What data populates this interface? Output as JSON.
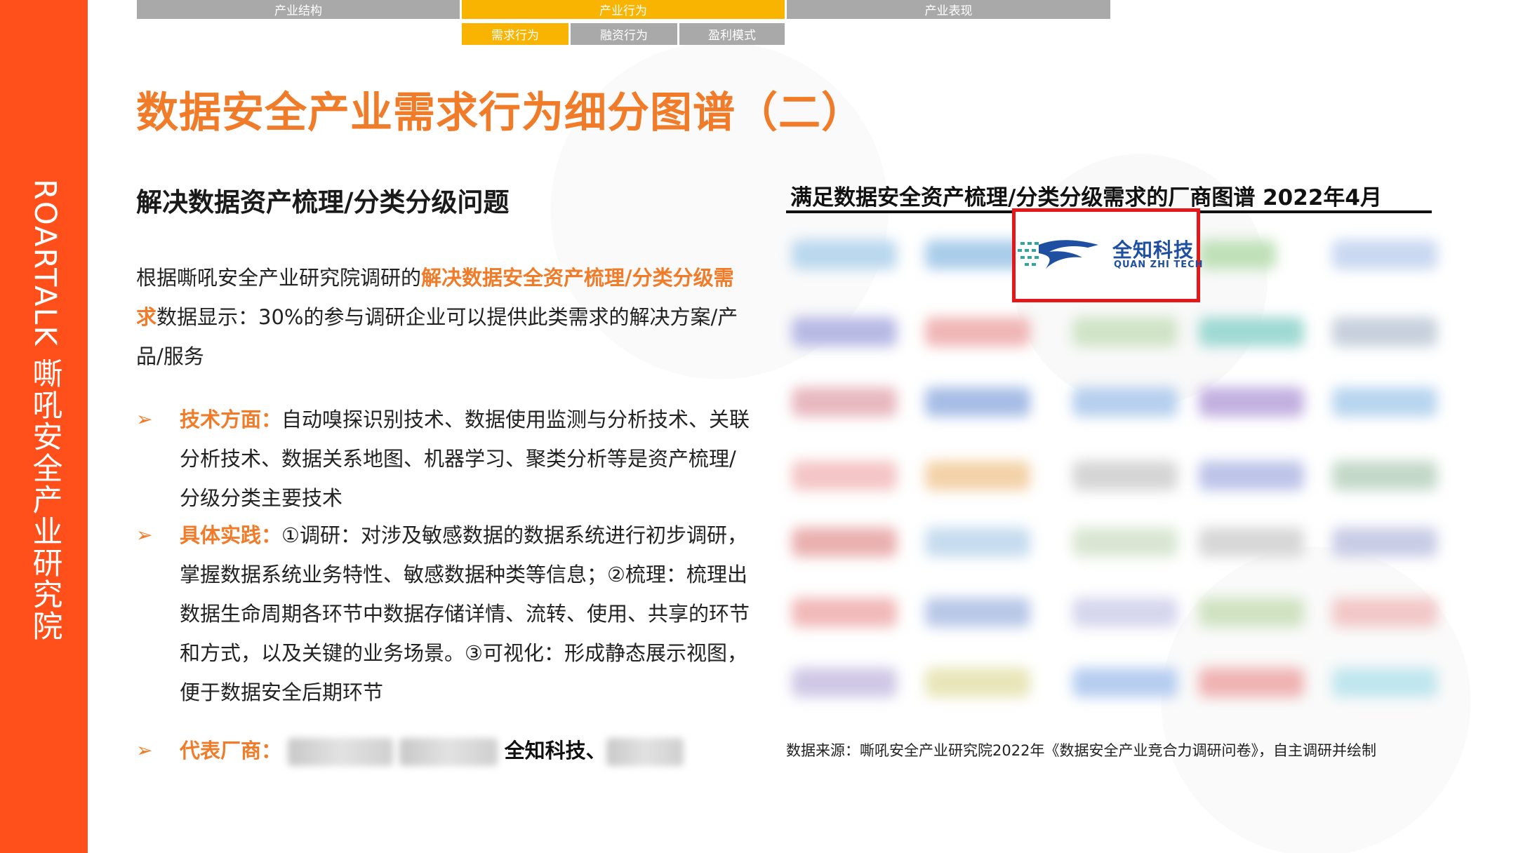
{
  "sidebar": {
    "text": "ROARTALK 嘶吼安全产业研究院"
  },
  "nav": {
    "top": [
      "产业结构",
      "产业行为",
      "产业表现"
    ],
    "sub": [
      "需求行为",
      "融资行为",
      "盈利模式"
    ],
    "active_top": "产业行为",
    "active_sub": "需求行为"
  },
  "page": {
    "title": "数据安全产业需求行为细分图谱（二）",
    "section_heading": "解决数据资产梳理/分类分级问题",
    "intro": {
      "pre": "根据嘶吼安全产业研究院调研的",
      "highlight": "解决数据安全资产梳理/分类分级需求",
      "post": "数据显示：30%的参与调研企业可以提供此类需求的解决方案/产品/服务"
    },
    "bullets": [
      {
        "label": "技术方面：",
        "text": "自动嗅探识别技术、数据使用监测与分析技术、关联分析技术、数据关系地图、机器学习、聚类分析等是资产梳理/分级分类主要技术"
      },
      {
        "label": "具体实践：",
        "text": "①调研：对涉及敏感数据的数据系统进行初步调研，掌握数据系统业务特性、敏感数据种类等信息；②梳理：梳理出数据生命周期各环节中数据存储详情、流转、使用、共享的环节和方式，以及关键的业务场景。③可视化：形成静态展示视图，便于数据安全后期环节"
      },
      {
        "label": "代表厂商：",
        "named_vendor": "全知科技、"
      }
    ]
  },
  "map": {
    "title": "满足数据安全资产梳理/分类分级需求的厂商图谱 2022年4月",
    "highlighted_vendor": {
      "name_cn": "全知科技",
      "name_en": "QUAN ZHI TECH",
      "logo_color": "#1f4fa0",
      "highlight_border": "#e41818"
    },
    "source": "数据来源：嘶吼安全产业研究院2022年《数据安全产业竞合力调研问卷》，自主调研并绘制"
  },
  "colors": {
    "sidebar": "#ff4f1a",
    "accent_orange": "#f07c2a",
    "nav_active": "#f8b400",
    "nav_inactive": "#a9a9a9"
  }
}
